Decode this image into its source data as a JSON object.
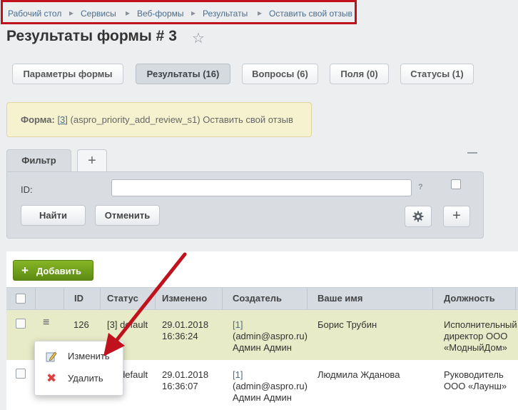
{
  "breadcrumb": [
    "Рабочий стол",
    "Сервисы",
    "Веб-формы",
    "Результаты",
    "Оставить свой отзыв"
  ],
  "page": {
    "title": "Результаты формы # 3"
  },
  "tabs": [
    {
      "label": "Параметры формы"
    },
    {
      "label": "Результаты (16)"
    },
    {
      "label": "Вопросы (6)"
    },
    {
      "label": "Поля (0)"
    },
    {
      "label": "Статусы (1)"
    }
  ],
  "info": {
    "label": "Форма:",
    "link": "[3]",
    "text": " (aspro_priority_add_review_s1) Оставить свой отзыв"
  },
  "filter": {
    "tab_label": "Фильтр",
    "id_label": "ID:",
    "id_value": "",
    "help": "?",
    "find_button": "Найти",
    "cancel_button": "Отменить"
  },
  "toolbar": {
    "add_button": "Добавить"
  },
  "table": {
    "columns": [
      "ID",
      "Статус",
      "Изменено",
      "Создатель",
      "Ваше имя",
      "Должность"
    ],
    "rows": [
      {
        "id": "126",
        "status": "[3] default",
        "changed_date": "29.01.2018",
        "changed_time": "16:36:24",
        "creator_line1": "[1]",
        "creator_line2": "(admin@aspro.ru)",
        "creator_line3": "Админ Админ",
        "name": "Борис Трубин",
        "position_line1": "Исполнительный",
        "position_line2": "директор ООО",
        "position_line3": "«МодныйДом»"
      },
      {
        "id": "",
        "status": "[3] default",
        "changed_date": "29.01.2018",
        "changed_time": "16:36:07",
        "creator_line1": "[1]",
        "creator_line2": "(admin@aspro.ru)",
        "creator_line3": "Админ Админ",
        "name": "Людмила Жданова",
        "position_line1": "Руководитель",
        "position_line2": "ООО «Лаунш»"
      }
    ]
  },
  "context_menu": {
    "edit": "Изменить",
    "delete": "Удалить"
  },
  "colors": {
    "highlight_border": "#c0121c",
    "arrow": "#c0121c",
    "add_button": "#6f9e1b",
    "selected_row": "#e8ebc7"
  },
  "icons": [
    "star-icon",
    "plus-icon",
    "gear-icon",
    "menu-icon",
    "edit-icon",
    "delete-icon"
  ]
}
